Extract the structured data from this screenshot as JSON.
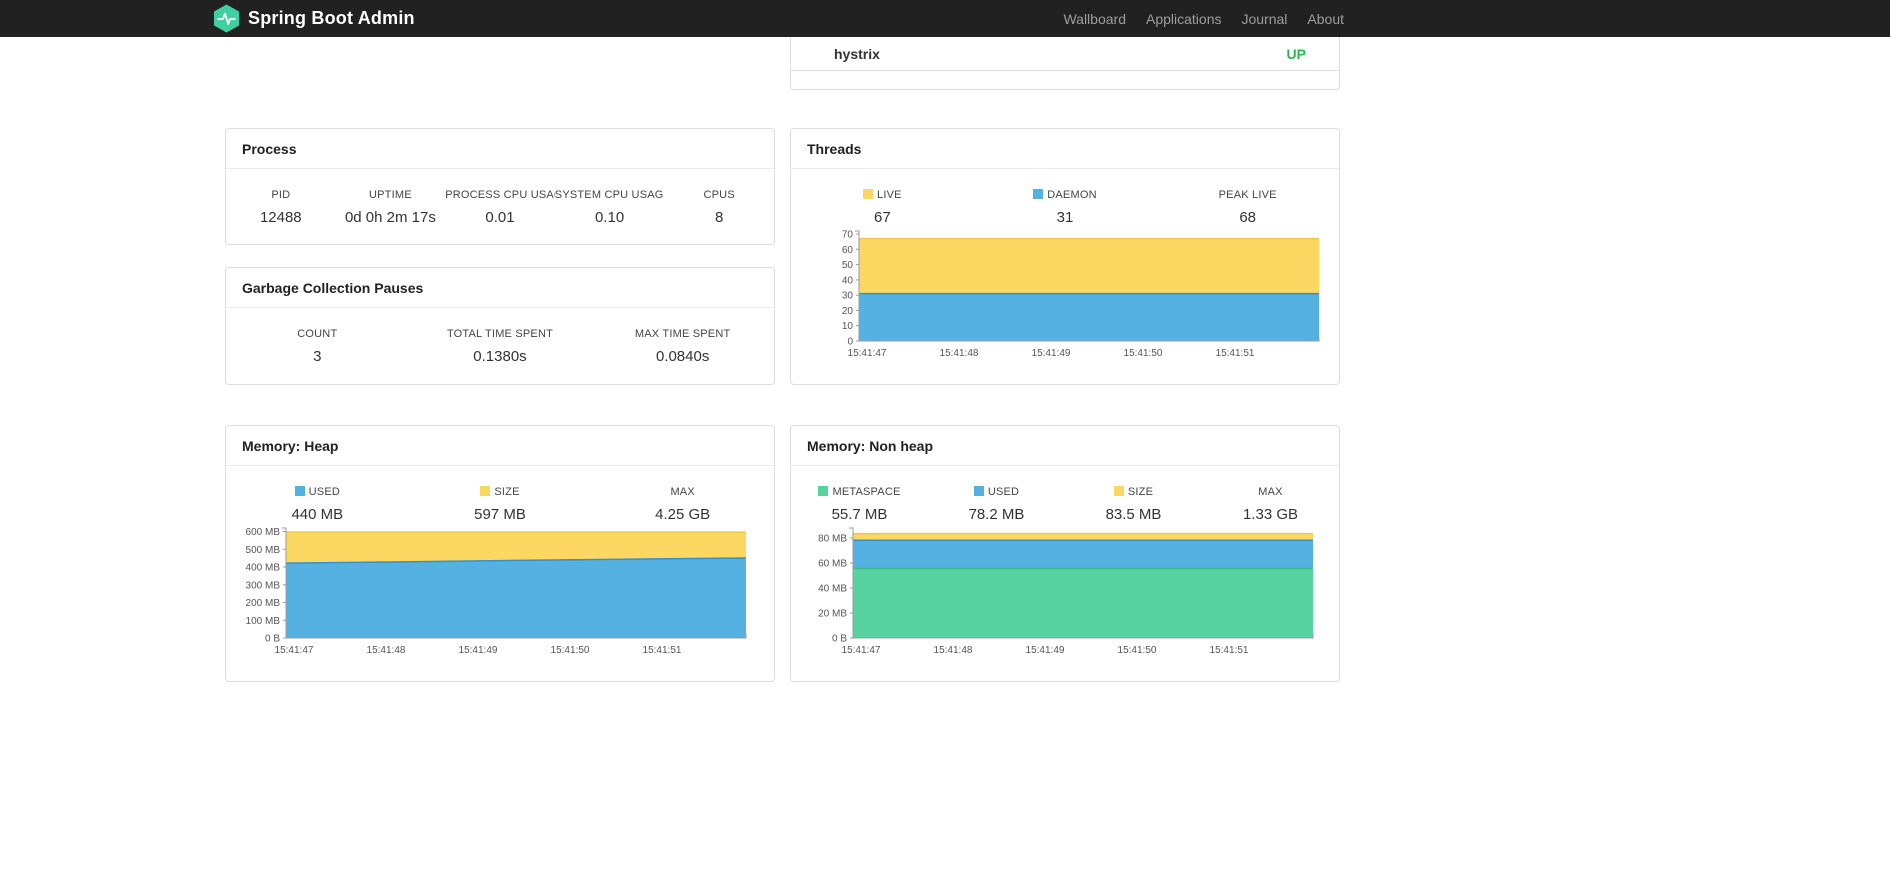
{
  "theme": {
    "brand_color": "#3ed0a0",
    "status_up_color": "#2ab54d"
  },
  "navbar": {
    "brand": "Spring Boot Admin",
    "items": [
      {
        "label": "Wallboard"
      },
      {
        "label": "Applications"
      },
      {
        "label": "Journal"
      },
      {
        "label": "About"
      }
    ]
  },
  "application_status": {
    "service": "hystrix",
    "status": "UP"
  },
  "process_card": {
    "title": "Process",
    "metrics": [
      {
        "label": "PID",
        "value": "12488"
      },
      {
        "label": "UPTIME",
        "value": "0d 0h 2m 17s"
      },
      {
        "label": "PROCESS CPU USAGE",
        "value": "0.01"
      },
      {
        "label": "SYSTEM CPU USAGE",
        "value": "0.10"
      },
      {
        "label": "CPUS",
        "value": "8"
      }
    ]
  },
  "gc_card": {
    "title": "Garbage Collection Pauses",
    "metrics": [
      {
        "label": "COUNT",
        "value": "3"
      },
      {
        "label": "TOTAL TIME SPENT",
        "value": "0.1380s"
      },
      {
        "label": "MAX TIME SPENT",
        "value": "0.0840s"
      }
    ]
  },
  "threads_card": {
    "title": "Threads",
    "legend": [
      {
        "label": "LIVE",
        "value": "67",
        "color": "#fcd862"
      },
      {
        "label": "DAEMON",
        "value": "31",
        "color": "#55b1e2"
      },
      {
        "label": "PEAK LIVE",
        "value": "68"
      }
    ]
  },
  "heap_card": {
    "title": "Memory: Heap",
    "legend": [
      {
        "label": "USED",
        "value": "440 MB",
        "color": "#55b1e2"
      },
      {
        "label": "SIZE",
        "value": "597 MB",
        "color": "#fcd862"
      },
      {
        "label": "MAX",
        "value": "4.25 GB"
      }
    ]
  },
  "nonheap_card": {
    "title": "Memory: Non heap",
    "legend": [
      {
        "label": "METASPACE",
        "value": "55.7 MB",
        "color": "#57d3a2"
      },
      {
        "label": "USED",
        "value": "78.2 MB",
        "color": "#55b1e2"
      },
      {
        "label": "SIZE",
        "value": "83.5 MB",
        "color": "#fcd862"
      },
      {
        "label": "MAX",
        "value": "1.33 GB"
      }
    ]
  },
  "chart_data": [
    {
      "id": "threads",
      "type": "area",
      "stacked": true,
      "title": "Threads",
      "legend_position": "top",
      "grid": false,
      "x": [
        "15:41:47",
        "15:41:48",
        "15:41:49",
        "15:41:50",
        "15:41:51"
      ],
      "series": [
        {
          "name": "DAEMON",
          "fill": "#55b1e2",
          "line": "#3392cc",
          "values": [
            31,
            31,
            31,
            31,
            31,
            31
          ]
        },
        {
          "name": "LIVE",
          "fill": "#fcd862",
          "line": "#f3c64a",
          "values": [
            67,
            67,
            67,
            67,
            67,
            67
          ]
        }
      ],
      "ylim": [
        0,
        72
      ],
      "yticks": [
        {
          "v": 0,
          "label": "0"
        },
        {
          "v": 10,
          "label": "10"
        },
        {
          "v": 20,
          "label": "20"
        },
        {
          "v": 30,
          "label": "30"
        },
        {
          "v": 40,
          "label": "40"
        },
        {
          "v": 50,
          "label": "50"
        },
        {
          "v": 60,
          "label": "60"
        },
        {
          "v": 70,
          "label": "70"
        }
      ]
    },
    {
      "id": "memory-heap",
      "type": "area",
      "stacked": true,
      "title": "Memory: Heap",
      "legend_position": "top",
      "grid": false,
      "x": [
        "15:41:47",
        "15:41:48",
        "15:41:49",
        "15:41:50",
        "15:41:51"
      ],
      "series": [
        {
          "name": "USED",
          "fill": "#55b1e2",
          "line": "#3392cc",
          "values": [
            422,
            428,
            434,
            440,
            446,
            451
          ]
        },
        {
          "name": "SIZE",
          "fill": "#fcd862",
          "line": "#f3c64a",
          "values": [
            597,
            597,
            597,
            597,
            597,
            597
          ]
        }
      ],
      "ylim": [
        0,
        620
      ],
      "yticks": [
        {
          "v": 0,
          "label": "0 B"
        },
        {
          "v": 100,
          "label": "100 MB"
        },
        {
          "v": 200,
          "label": "200 MB"
        },
        {
          "v": 300,
          "label": "300 MB"
        },
        {
          "v": 400,
          "label": "400 MB"
        },
        {
          "v": 500,
          "label": "500 MB"
        },
        {
          "v": 600,
          "label": "600 MB"
        }
      ]
    },
    {
      "id": "memory-nonheap",
      "type": "area",
      "stacked": true,
      "title": "Memory: Non heap",
      "legend_position": "top",
      "grid": false,
      "x": [
        "15:41:47",
        "15:41:48",
        "15:41:49",
        "15:41:50",
        "15:41:51"
      ],
      "series": [
        {
          "name": "METASPACE",
          "fill": "#57d3a2",
          "line": "#38bd89",
          "values": [
            55.7,
            55.7,
            55.7,
            55.7,
            55.7,
            55.7
          ]
        },
        {
          "name": "USED",
          "fill": "#55b1e2",
          "line": "#3392cc",
          "values": [
            78.2,
            78.2,
            78.2,
            78.2,
            78.2,
            78.2
          ]
        },
        {
          "name": "SIZE",
          "fill": "#fcd862",
          "line": "#f3c64a",
          "values": [
            83.5,
            83.5,
            83.5,
            83.5,
            83.5,
            83.5
          ]
        }
      ],
      "ylim": [
        0,
        88
      ],
      "yticks": [
        {
          "v": 0,
          "label": "0 B"
        },
        {
          "v": 20,
          "label": "20 MB"
        },
        {
          "v": 40,
          "label": "40 MB"
        },
        {
          "v": 60,
          "label": "60 MB"
        },
        {
          "v": 80,
          "label": "80 MB"
        }
      ]
    }
  ]
}
